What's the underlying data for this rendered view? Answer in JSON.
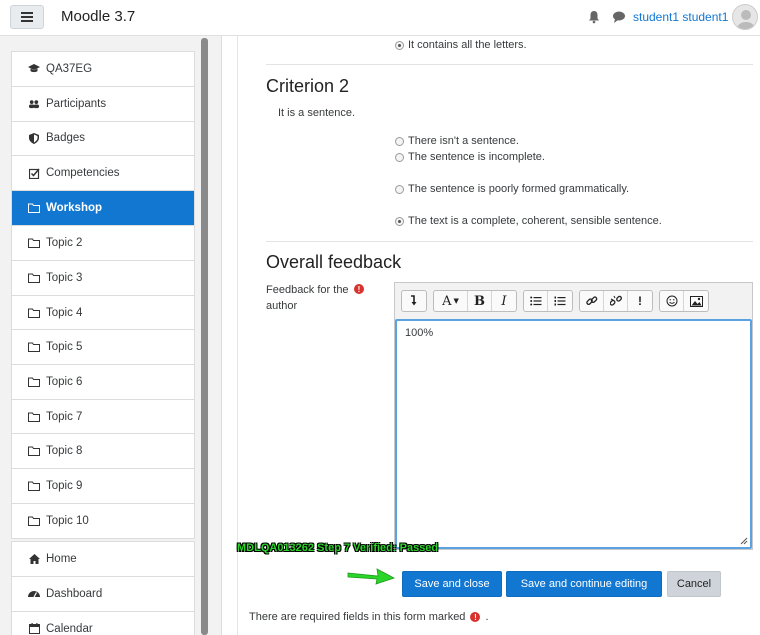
{
  "navbar": {
    "brand": "Moodle 3.7",
    "user_name": "student1 student1"
  },
  "sidebar": {
    "course_items": [
      {
        "label": "QA37EG",
        "icon": "graduation-cap-icon"
      },
      {
        "label": "Participants",
        "icon": "users-icon"
      },
      {
        "label": "Badges",
        "icon": "shield-icon"
      },
      {
        "label": "Competencies",
        "icon": "checkbox-icon"
      },
      {
        "label": "Workshop",
        "icon": "folder-icon",
        "active": true
      },
      {
        "label": "Topic 2",
        "icon": "folder-icon"
      },
      {
        "label": "Topic 3",
        "icon": "folder-icon"
      },
      {
        "label": "Topic 4",
        "icon": "folder-icon"
      }
    ],
    "topic_items": [
      {
        "label": "Topic 5",
        "icon": "folder-icon"
      },
      {
        "label": "Topic 6",
        "icon": "folder-icon"
      },
      {
        "label": "Topic 7",
        "icon": "folder-icon"
      }
    ],
    "topic_items2": [
      {
        "label": "Topic 8",
        "icon": "folder-icon"
      },
      {
        "label": "Topic 9",
        "icon": "folder-icon"
      },
      {
        "label": "Topic 10",
        "icon": "folder-icon"
      }
    ],
    "site_items": [
      {
        "label": "Home",
        "icon": "home-icon"
      },
      {
        "label": "Dashboard",
        "icon": "dashboard-icon"
      },
      {
        "label": "Calendar",
        "icon": "calendar-icon"
      }
    ]
  },
  "criterion1": {
    "selected_option": "It contains all the letters."
  },
  "criterion2": {
    "title": "Criterion 2",
    "description": "It is a sentence.",
    "options": [
      {
        "label": "There isn't a sentence.",
        "checked": false
      },
      {
        "label": "The sentence is incomplete.",
        "checked": false
      },
      {
        "label": "The sentence is poorly formed grammatically.",
        "checked": false
      },
      {
        "label": "The text is a complete, coherent, sensible sentence.",
        "checked": true
      }
    ]
  },
  "overall": {
    "title": "Overall feedback",
    "field_label": "Feedback for the author",
    "feedback_value": "100%"
  },
  "editor_toolbar": {
    "icons": [
      "expand-toolbar-icon",
      "font-color-icon",
      "bold-icon",
      "italic-icon",
      "bullet-list-icon",
      "numbered-list-icon",
      "link-icon",
      "unlink-icon",
      "exclamation-icon",
      "emoticon-icon",
      "image-icon"
    ]
  },
  "stamp_text": "MDLQA013262 Step 7 Verified: Passed",
  "buttons": {
    "save_close": "Save and close",
    "save_continue": "Save and continue editing",
    "cancel": "Cancel"
  },
  "footer": {
    "required_note": "There are required fields in this form marked",
    "period": "."
  },
  "colors": {
    "primary": "#1177d1",
    "required": "#d9322d",
    "stamp": "#2ad52a"
  }
}
